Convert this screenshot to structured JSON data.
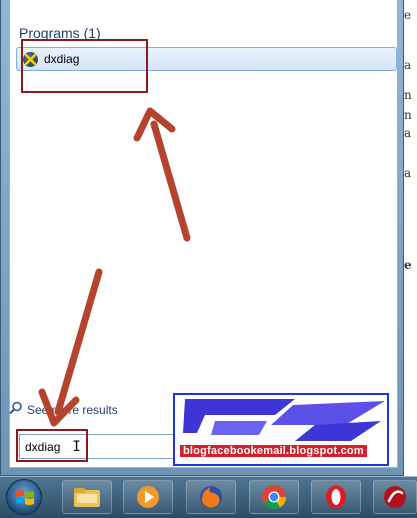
{
  "start_menu": {
    "programs_header": "Programs (1)",
    "programs": [
      {
        "label": "dxdiag",
        "icon": "directx-icon"
      }
    ],
    "see_more_label": "See more results",
    "search": {
      "value": "dxdiag"
    }
  },
  "watermark": {
    "text": "blogfacebookemail.blogspot.com"
  },
  "taskbar": {
    "items": [
      {
        "name": "start-button",
        "icon": "windows-orb-icon"
      },
      {
        "name": "windows-explorer",
        "icon": "folder-icon"
      },
      {
        "name": "media-player",
        "icon": "media-player-icon"
      },
      {
        "name": "firefox",
        "icon": "firefox-icon"
      },
      {
        "name": "chrome",
        "icon": "chrome-icon"
      },
      {
        "name": "opera",
        "icon": "opera-icon"
      },
      {
        "name": "app",
        "icon": "red-app-icon"
      }
    ]
  },
  "colors": {
    "annotation": "#8b1b1b",
    "accent_blue": "#1e3f6e",
    "watermark_border": "#1d35e0",
    "watermark_banner": "#d41f2c"
  }
}
